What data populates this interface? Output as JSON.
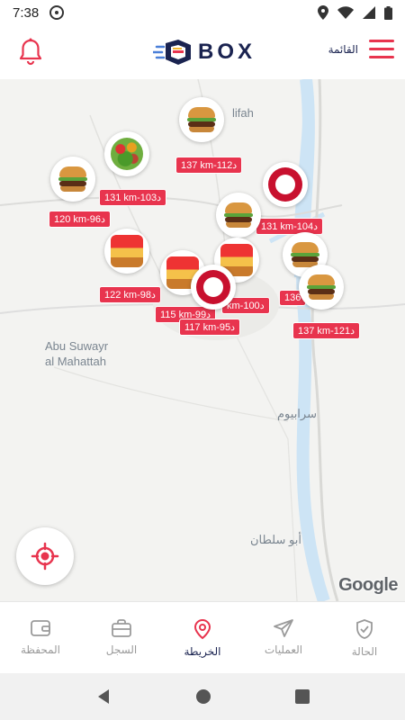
{
  "status_bar": {
    "time": "7:38"
  },
  "app": {
    "logo_text": "BOX",
    "menu_label": "القائمة"
  },
  "map": {
    "labels": [
      {
        "text": "lifah"
      },
      {
        "text": "Abu Suwayr\nal Mahattah"
      },
      {
        "text": "سرابيوم"
      },
      {
        "text": "أبو سلطان"
      }
    ],
    "attribution": "Google",
    "markers": [
      {
        "type": "burger",
        "distance": "137 km-112د"
      },
      {
        "type": "veggies",
        "distance": "131 km-103د"
      },
      {
        "type": "burger",
        "distance": "120 km-96د"
      },
      {
        "type": "kfc",
        "distance": "131 km-104د"
      },
      {
        "type": "burger",
        "distance": ""
      },
      {
        "type": "meal",
        "distance": "122 km-98د"
      },
      {
        "type": "meal",
        "distance": "115 km-99د"
      },
      {
        "type": "kfc",
        "distance": "117 km-95د"
      },
      {
        "type": "meal",
        "distance": "km-100د"
      },
      {
        "type": "burger",
        "distance": "136"
      },
      {
        "type": "burger",
        "distance": "137 km-121د"
      }
    ]
  },
  "bottom_nav": [
    {
      "label": "المحفظة",
      "icon": "wallet-icon"
    },
    {
      "label": "السجل",
      "icon": "briefcase-icon"
    },
    {
      "label": "الخريطة",
      "icon": "map-pin-icon",
      "active": true
    },
    {
      "label": "العمليات",
      "icon": "send-icon"
    },
    {
      "label": "الحالة",
      "icon": "shield-check-icon"
    }
  ],
  "colors": {
    "accent": "#e8344e",
    "navy": "#1a2350"
  }
}
